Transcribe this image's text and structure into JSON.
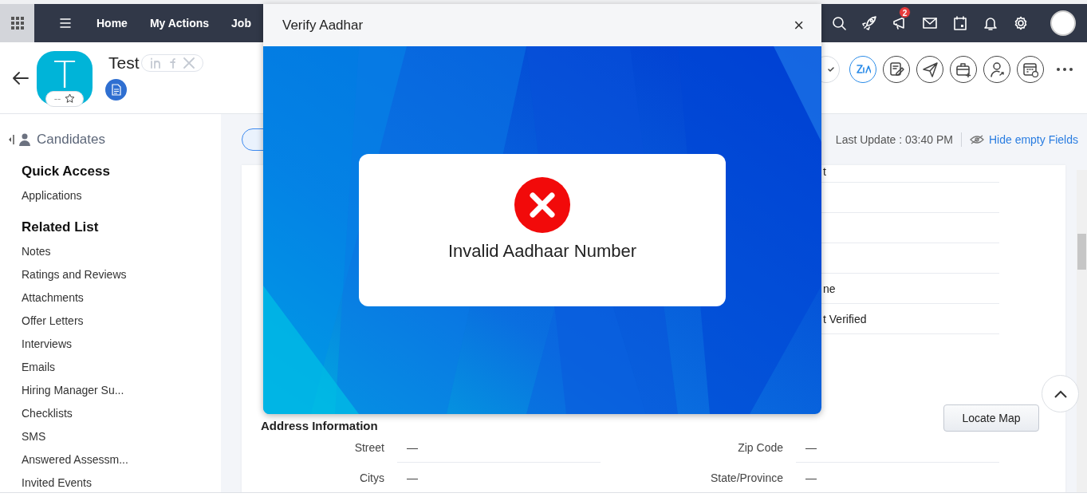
{
  "top_nav": {
    "items": [
      {
        "label": "Home"
      },
      {
        "label": "My Actions"
      },
      {
        "label": "Job"
      }
    ],
    "notification_count": "2"
  },
  "record": {
    "avatar_letter": "T",
    "rating": "--",
    "name": "Test"
  },
  "sidebar": {
    "module": "Candidates",
    "sections": [
      {
        "title": "Quick Access",
        "items": [
          "Applications"
        ]
      },
      {
        "title": "Related List",
        "items": [
          "Notes",
          "Ratings and Reviews",
          "Attachments",
          "Offer Letters",
          "Interviews",
          "Emails",
          "Hiring Manager Su...",
          "Checklists",
          "SMS",
          "Answered Assessm...",
          "Invited Events"
        ]
      }
    ]
  },
  "toolbar": {
    "last_update": "Last Update : 03:40 PM",
    "hide_empty": "Hide empty Fields"
  },
  "detail_rows": [
    {
      "kind": "text",
      "value": "t"
    },
    {
      "kind": "blank"
    },
    {
      "kind": "blank"
    },
    {
      "kind": "blank"
    },
    {
      "kind": "text",
      "value": "ne"
    },
    {
      "kind": "text",
      "value": "t Verified"
    }
  ],
  "address": {
    "title": "Address Information",
    "button": "Locate Map",
    "fields": [
      {
        "label": "Street",
        "value": "—"
      },
      {
        "label": "Zip Code",
        "value": "—"
      },
      {
        "label": "Citys",
        "value": "—"
      },
      {
        "label": "State/Province",
        "value": "—"
      }
    ]
  },
  "dialog": {
    "title": "Verify Aadhar",
    "close": "×",
    "message": "Invalid Aadhaar Number"
  }
}
